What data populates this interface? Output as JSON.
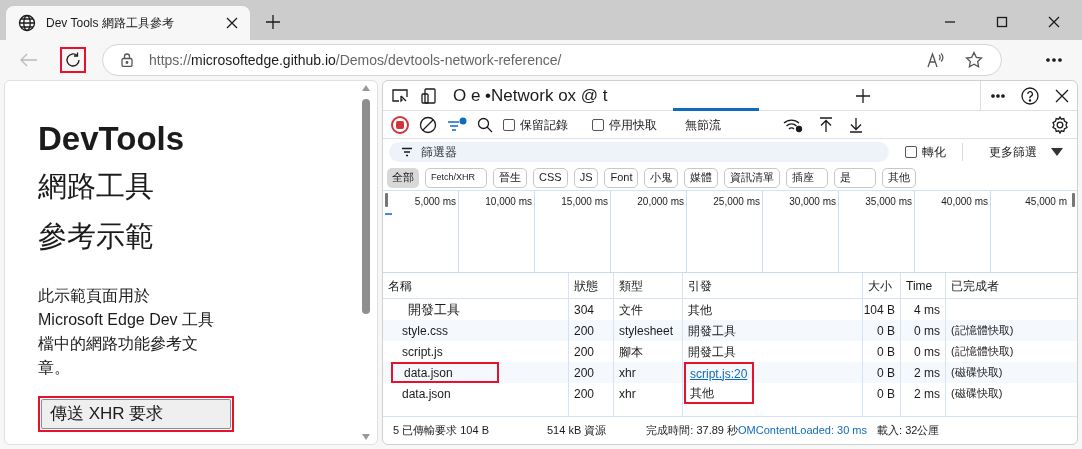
{
  "browser": {
    "tab_title": "Dev Tools 網路工具參考",
    "url_scheme": "https://",
    "url_host": "microsoftedge.github.io",
    "url_path": "/Demos/devtools-network-reference/",
    "reload_highlighted": true
  },
  "page": {
    "heading": "DevTools",
    "subheading_1": "網路工具",
    "subheading_2": "參考示範",
    "paragraph": "此示範頁面用於 Microsoft Edge Dev 工具檔中的網路功能參考文章。",
    "button": "傳送 XHR 要求",
    "button_highlighted": true
  },
  "devtools": {
    "tab_strip_text": "O e •Network ox @ t",
    "toolbar": {
      "recording": true,
      "preserve_log": {
        "label": "保留記錄",
        "checked": false
      },
      "disable_cache": {
        "label": "停用快取",
        "checked": false
      },
      "throttling": "無節流"
    },
    "filter": {
      "placeholder": "篩選器",
      "invert": {
        "label": "轉化",
        "checked": false
      },
      "more_filters": "更多篩選"
    },
    "type_filters": [
      {
        "label": "全部",
        "selected": true
      },
      {
        "label": "Fetch/XHR",
        "selected": false
      },
      {
        "label": "晉生",
        "selected": false
      },
      {
        "label": "CSS",
        "selected": false
      },
      {
        "label": "JS",
        "selected": false
      },
      {
        "label": "Font",
        "selected": false
      },
      {
        "label": "小鬼",
        "selected": false
      },
      {
        "label": "媒體",
        "selected": false
      },
      {
        "label": "資訊清單",
        "selected": false
      },
      {
        "label": "插座",
        "selected": false
      },
      {
        "label": "是",
        "selected": false
      },
      {
        "label": "其他",
        "selected": false
      }
    ],
    "timeline_ticks": [
      "5,000 ms",
      "10,000 ms",
      "15,000 ms",
      "20,000 ms",
      "25,000 ms",
      "30,000 ms",
      "35,000 ms",
      "40,000 ms",
      "45,000 m"
    ],
    "table": {
      "columns": [
        "名稱",
        "狀態",
        "類型",
        "引發",
        "大小",
        "Time",
        "已完成者"
      ],
      "rows": [
        {
          "name": "開發工具",
          "status": "304",
          "type": "文件",
          "initiator": "其他",
          "initiator_link": false,
          "size": "104 B",
          "time": "4 ms",
          "fulfilled_by": "",
          "name_highlighted": false,
          "initiator_highlighted": false
        },
        {
          "name": "style.css",
          "status": "200",
          "type": "stylesheet",
          "initiator": "開發工具",
          "initiator_link": false,
          "size": "0 B",
          "time": "0 ms",
          "fulfilled_by": "(記憶體快取)",
          "name_highlighted": false,
          "initiator_highlighted": false
        },
        {
          "name": "script.js",
          "status": "200",
          "type": "腳本",
          "initiator": "開發工具",
          "initiator_link": false,
          "size": "0 B",
          "time": "0 ms",
          "fulfilled_by": "(記憶體快取)",
          "name_highlighted": false,
          "initiator_highlighted": false
        },
        {
          "name": "data.json",
          "status": "200",
          "type": "xhr",
          "initiator": "script.js:20",
          "initiator_link": true,
          "size": "0 B",
          "time": "2 ms",
          "fulfilled_by": "(磁碟快取)",
          "name_highlighted": true,
          "initiator_highlighted": true
        },
        {
          "name": "data.json",
          "status": "200",
          "type": "xhr",
          "initiator": "其他",
          "initiator_link": false,
          "size": "0 B",
          "time": "2 ms",
          "fulfilled_by": "(磁碟快取)",
          "name_highlighted": false,
          "initiator_highlighted": true
        }
      ]
    },
    "status_bar": [
      {
        "text": "5 已傳輸要求 104 B",
        "kind": "plain"
      },
      {
        "text": "514 kB 資源",
        "kind": "plain"
      },
      {
        "text": "完成時間: 37.89 秒",
        "kind": "plain"
      },
      {
        "text": "OMContentLoaded: 30 ms",
        "kind": "blue"
      },
      {
        "text": "載入: 32公厘",
        "kind": "plain"
      }
    ]
  }
}
